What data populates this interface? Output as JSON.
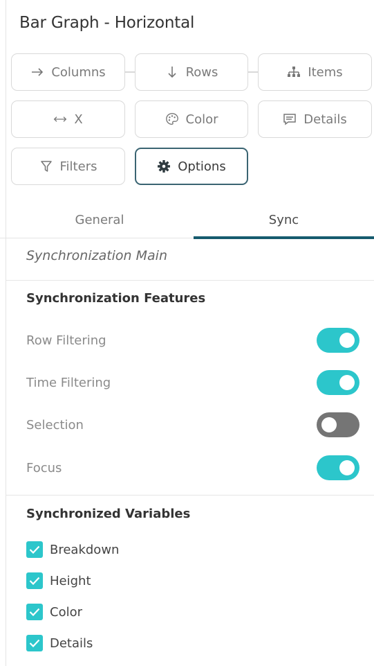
{
  "panel": {
    "title": "Bar Graph - Horizontal"
  },
  "buttons": {
    "columns": "Columns",
    "rows": "Rows",
    "items": "Items",
    "x": "X",
    "color": "Color",
    "details": "Details",
    "filters": "Filters",
    "options": "Options"
  },
  "tabs": [
    {
      "label": "General",
      "active": false
    },
    {
      "label": "Sync",
      "active": true
    }
  ],
  "section_main": "Synchronization Main",
  "features": {
    "heading": "Synchronization Features",
    "items": [
      {
        "label": "Row Filtering",
        "on": true
      },
      {
        "label": "Time Filtering",
        "on": true
      },
      {
        "label": "Selection",
        "on": false
      },
      {
        "label": "Focus",
        "on": true
      }
    ]
  },
  "variables": {
    "heading": "Synchronized Variables",
    "items": [
      {
        "label": "Breakdown",
        "checked": true
      },
      {
        "label": "Height",
        "checked": true
      },
      {
        "label": "Color",
        "checked": true
      },
      {
        "label": "Details",
        "checked": true
      }
    ]
  },
  "colors": {
    "accent": "#2cc6cb",
    "tab_underline": "#165b6e",
    "active_border": "#3a6472",
    "toggle_off": "#757575"
  }
}
